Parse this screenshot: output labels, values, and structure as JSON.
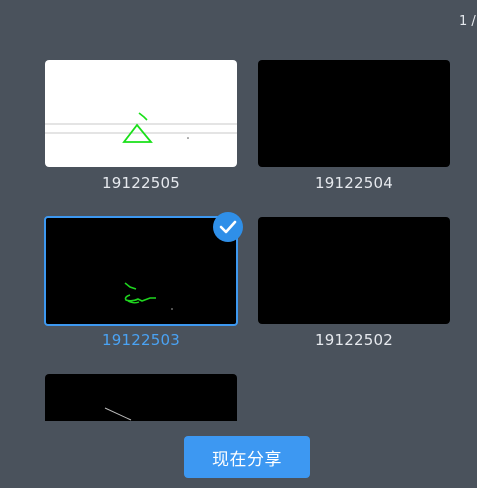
{
  "page_indicator": "1 /",
  "items": [
    {
      "label": "19122505",
      "thumbnail": "white",
      "selected": false
    },
    {
      "label": "19122504",
      "thumbnail": "black",
      "selected": false
    },
    {
      "label": "19122503",
      "thumbnail": "black",
      "selected": true
    },
    {
      "label": "19122502",
      "thumbnail": "black",
      "selected": false
    },
    {
      "label": "",
      "thumbnail": "black",
      "selected": false
    }
  ],
  "selection_icon": "checkmark-icon",
  "share_button_label": "现在分享",
  "colors": {
    "background": "#4a525c",
    "accent": "#3d98f2",
    "selected_text": "#4aa3f4",
    "label_text": "#e6e9ee"
  }
}
